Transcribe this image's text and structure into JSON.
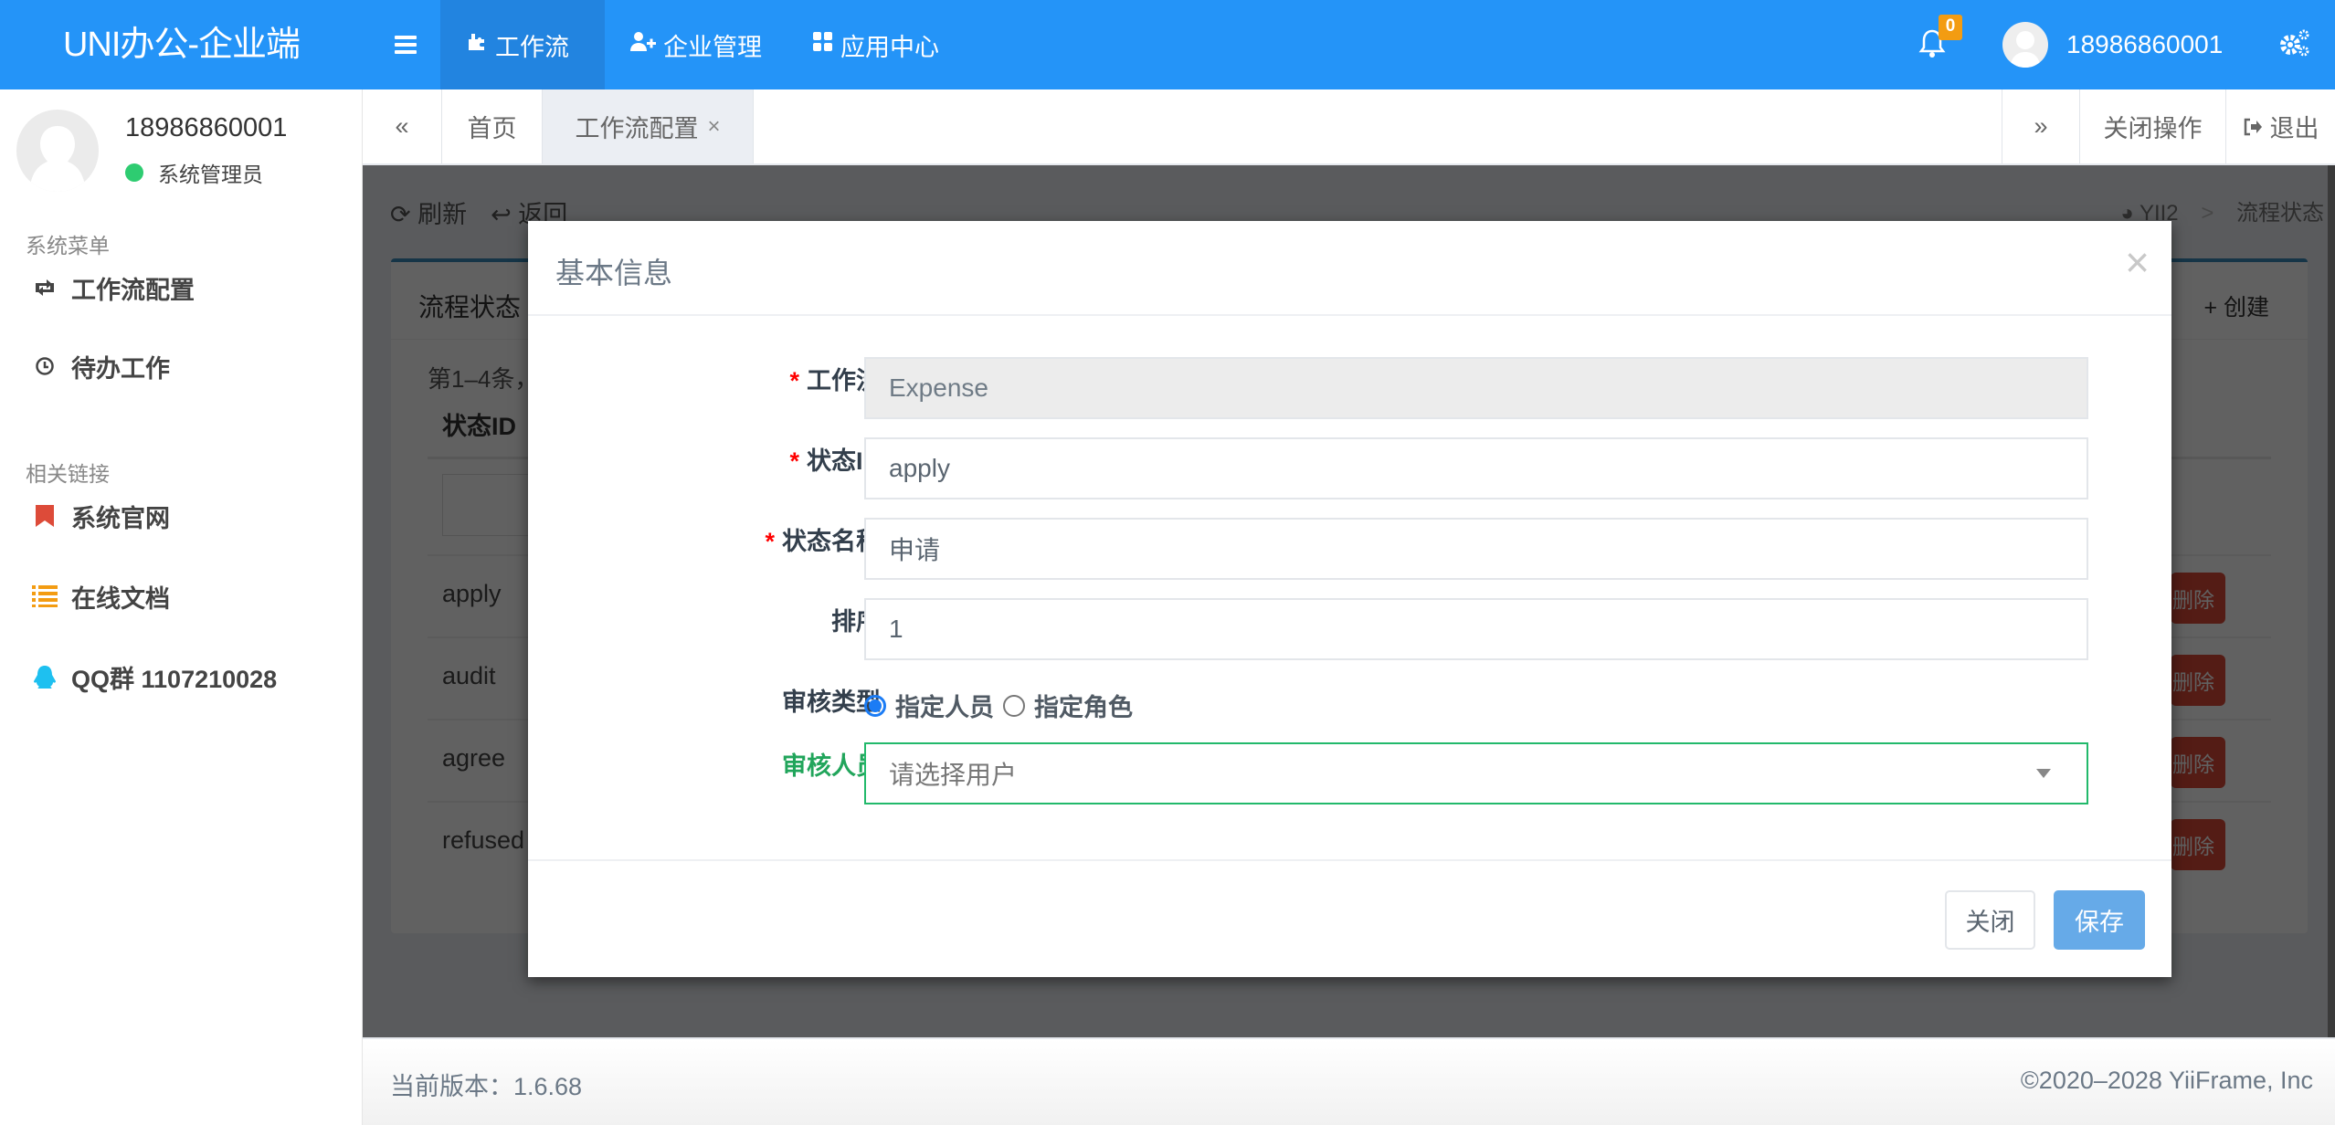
{
  "app": {
    "brand": "UNI办公-企业端"
  },
  "topnav": {
    "items": [
      {
        "label": "工作流",
        "icon": "puzzle-icon",
        "active": true
      },
      {
        "label": "企业管理",
        "icon": "user-plus-icon",
        "active": false
      },
      {
        "label": "应用中心",
        "icon": "grid-icon",
        "active": false
      }
    ],
    "notification_count": "0",
    "username": "18986860001"
  },
  "sidebar": {
    "username": "18986860001",
    "role": "系统管理员",
    "status_color": "#2ecc71",
    "section_menu": "系统菜单",
    "menu_items": [
      {
        "label": "工作流配置",
        "icon": "retweet-icon"
      },
      {
        "label": "待办工作",
        "icon": "clock-icon"
      }
    ],
    "section_links": "相关链接",
    "link_items": [
      {
        "label": "系统官网",
        "icon": "bookmark-icon",
        "color": "#dd4b39"
      },
      {
        "label": "在线文档",
        "icon": "list-icon",
        "color": "#f39c12"
      },
      {
        "label": "QQ群 1107210028",
        "icon": "qq-icon",
        "color": "#1ec0f0"
      }
    ]
  },
  "tabs": {
    "prev": "«",
    "home": "首页",
    "active": "工作流配置",
    "active_close": "×",
    "next": "»",
    "close_ops": "关闭操作",
    "logout": "退出"
  },
  "content": {
    "refresh": "刷新",
    "back": "返回",
    "breadcrumb": [
      "YII2",
      "流程状态"
    ],
    "breadcrumb_sep": ">",
    "panel_title": "流程状态",
    "create": "创建",
    "summary": "第1–4条，",
    "column_header": "状态ID",
    "rows": [
      {
        "id": "apply",
        "action": "删除"
      },
      {
        "id": "audit",
        "action": "删除"
      },
      {
        "id": "agree",
        "action": "删除"
      },
      {
        "id": "refused",
        "action": "删除"
      }
    ]
  },
  "modal": {
    "title": "基本信息",
    "close_icon": "×",
    "fields": {
      "workflow": {
        "label": "工作流",
        "required": true,
        "value": "Expense",
        "disabled": true
      },
      "state_id": {
        "label": "状态ID",
        "required": true,
        "value": "apply"
      },
      "state_name": {
        "label": "状态名称",
        "required": true,
        "value": "申请"
      },
      "sort": {
        "label": "排序",
        "required": false,
        "value": "1"
      },
      "audit_type": {
        "label": "审核类型",
        "options": [
          "指定人员",
          "指定角色"
        ],
        "selected": "指定人员"
      },
      "auditor": {
        "label": "审核人员",
        "placeholder": "请选择用户"
      }
    },
    "close_label": "关闭",
    "save_label": "保存"
  },
  "footer": {
    "version": "当前版本：1.6.68",
    "copyright": "©2020–2028 YiiFrame, Inc"
  }
}
